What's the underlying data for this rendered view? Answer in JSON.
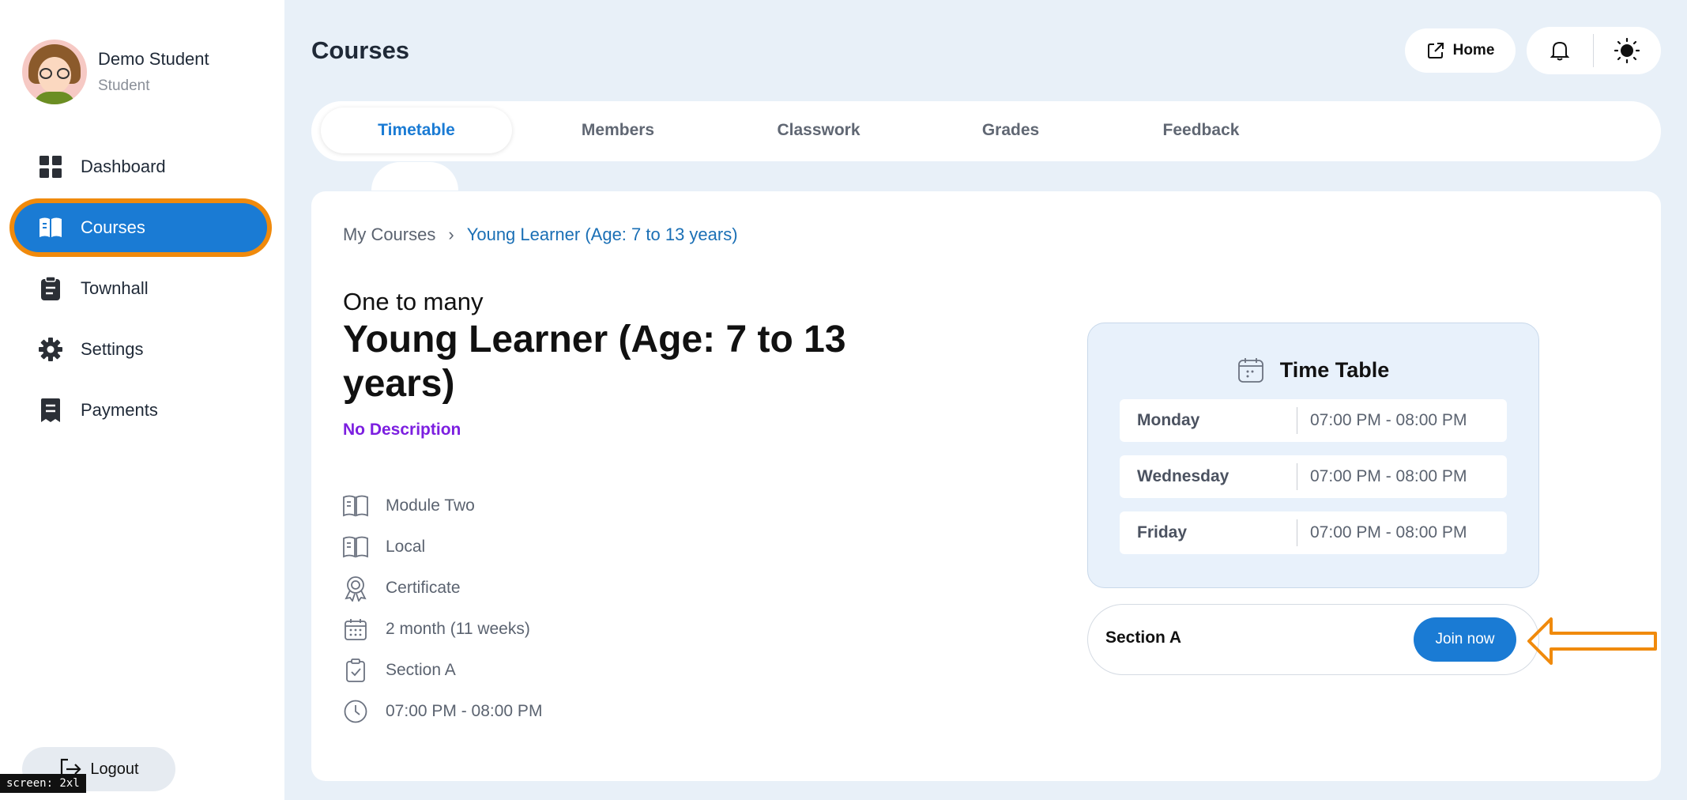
{
  "user": {
    "name": "Demo Student",
    "role": "Student"
  },
  "sidebar": {
    "items": [
      {
        "label": "Dashboard",
        "icon": "dashboard-icon"
      },
      {
        "label": "Courses",
        "icon": "book-open-icon",
        "active": true
      },
      {
        "label": "Townhall",
        "icon": "clipboard-icon"
      },
      {
        "label": "Settings",
        "icon": "gear-icon"
      },
      {
        "label": "Payments",
        "icon": "receipt-icon"
      }
    ],
    "logout_label": "Logout"
  },
  "header": {
    "title": "Courses",
    "home_label": "Home"
  },
  "tabs": [
    {
      "label": "Timetable",
      "active": true
    },
    {
      "label": "Members"
    },
    {
      "label": "Classwork"
    },
    {
      "label": "Grades"
    },
    {
      "label": "Feedback"
    }
  ],
  "breadcrumb": {
    "root": "My Courses",
    "separator": "›",
    "current": "Young Learner (Age: 7 to 13 years)"
  },
  "course": {
    "type": "One to many",
    "title": "Young Learner (Age: 7 to 13 years)",
    "description": "No Description",
    "meta": [
      {
        "icon": "book-icon",
        "text": "Module Two"
      },
      {
        "icon": "book-icon",
        "text": "Local"
      },
      {
        "icon": "award-icon",
        "text": "Certificate"
      },
      {
        "icon": "calendar-icon",
        "text": "2 month (11 weeks)"
      },
      {
        "icon": "clipboard-check-icon",
        "text": "Section A"
      },
      {
        "icon": "clock-icon",
        "text": "07:00 PM - 08:00 PM"
      }
    ]
  },
  "timetable": {
    "title": "Time Table",
    "rows": [
      {
        "day": "Monday",
        "time": "07:00 PM - 08:00 PM"
      },
      {
        "day": "Wednesday",
        "time": "07:00 PM - 08:00 PM"
      },
      {
        "day": "Friday",
        "time": "07:00 PM - 08:00 PM"
      }
    ]
  },
  "section": {
    "label": "Section A",
    "join_label": "Join now"
  },
  "debug": {
    "screen_tag": "screen: 2xl"
  },
  "colors": {
    "accent": "#1a7bd4",
    "highlight": "#f08a0c",
    "description": "#7c1fe0"
  }
}
